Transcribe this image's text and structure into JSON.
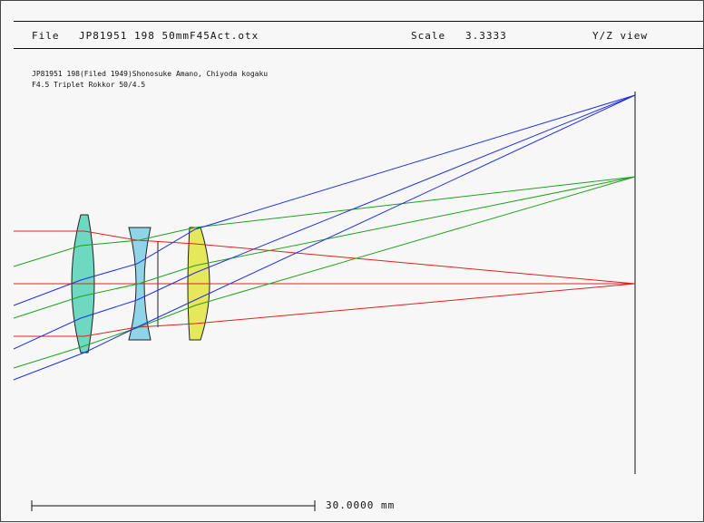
{
  "header": {
    "file_label": "File",
    "file_name": "JP81951 198 50mmF45Act.otx",
    "scale_label": "Scale",
    "scale_value": "3.3333",
    "view_label": "Y/Z view"
  },
  "description": {
    "line1": "JP81951 198(Filed 1949)Shonosuke Amano, Chiyoda kogaku",
    "line2": "F4.5 Triplet Rokkor 50/4.5"
  },
  "scale_bar": {
    "label": "30.0000 mm"
  },
  "colors": {
    "lens1": "#6fd8c0",
    "lens2": "#8fd4e8",
    "lens3": "#e4e85a",
    "ray_axis": "#e02020",
    "ray_mid": "#20a020",
    "ray_edge": "#2030e0",
    "outline": "#222222"
  }
}
